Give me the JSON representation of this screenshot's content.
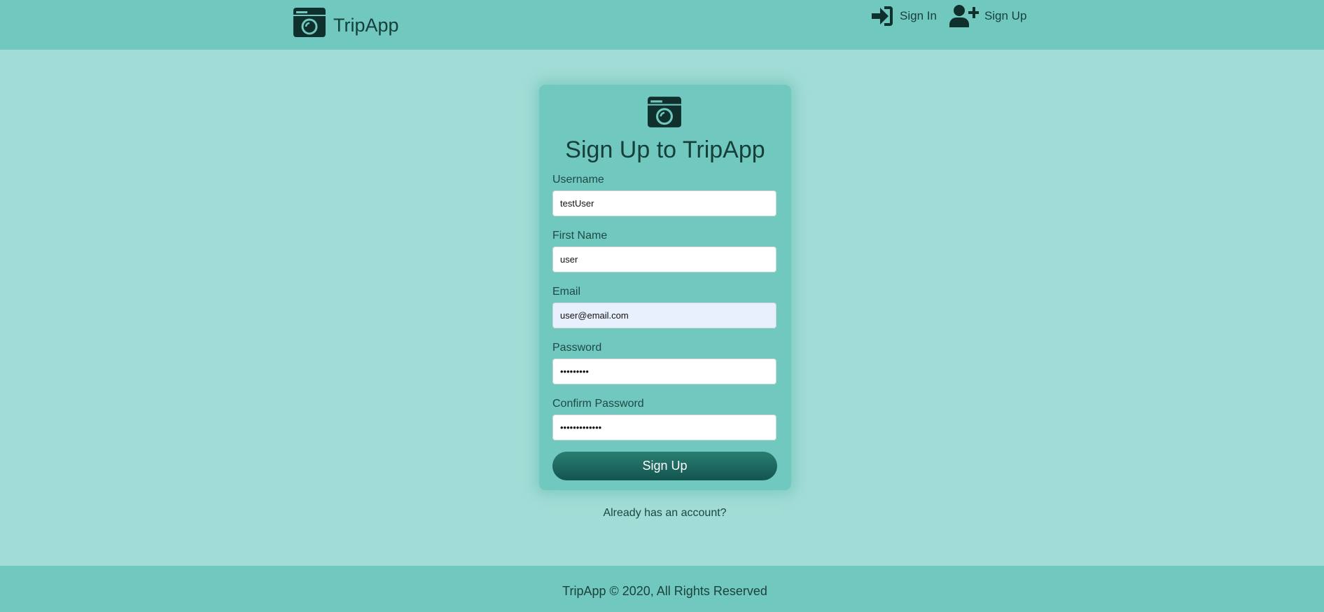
{
  "navbar": {
    "brand": "TripApp",
    "brand_icon": "camera-icon",
    "links": [
      {
        "label": "Sign In",
        "icon": "sign-in-icon"
      },
      {
        "label": "Sign Up",
        "icon": "user-plus-icon"
      }
    ]
  },
  "form": {
    "icon": "camera-icon",
    "title": "Sign Up to TripApp",
    "fields": [
      {
        "label": "Username",
        "value": "testUser",
        "type": "text"
      },
      {
        "label": "First Name",
        "value": "user",
        "type": "text"
      },
      {
        "label": "Email",
        "value": "user@email.com",
        "type": "email"
      },
      {
        "label": "Password",
        "value": "•••••••••",
        "type": "password"
      },
      {
        "label": "Confirm Password",
        "value": "•••••••••••••",
        "type": "password"
      }
    ],
    "submit_label": "Sign Up",
    "switch_link": "Already has an account?"
  },
  "footer": {
    "text": "TripApp © 2020, All Rights Reserved"
  },
  "colors": {
    "page_bg": "#a2dcd6",
    "bar_bg": "#71c8bf",
    "button": "#1a6a61",
    "text": "#17403b"
  }
}
